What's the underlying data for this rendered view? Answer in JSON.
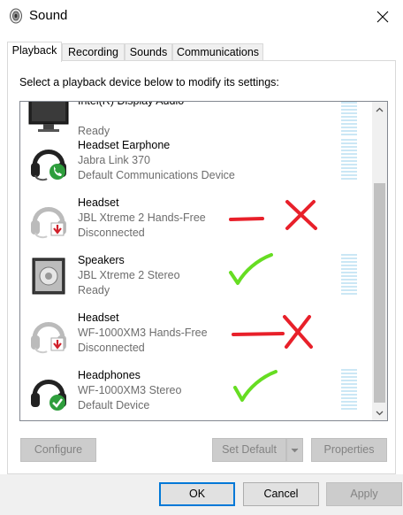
{
  "window": {
    "title": "Sound",
    "icon": "speaker-icon",
    "close_icon": "close-icon"
  },
  "tabs": [
    {
      "label": "Playback",
      "active": true
    },
    {
      "label": "Recording",
      "active": false
    },
    {
      "label": "Sounds",
      "active": false
    },
    {
      "label": "Communications",
      "active": false
    }
  ],
  "instruction": "Select a playback device below to modify its settings:",
  "devices": [
    {
      "name": "Intel(R) Display Audio",
      "description": "",
      "status": "Ready",
      "icon": "monitor-icon",
      "badge": ""
    },
    {
      "name": "Headset Earphone",
      "description": "Jabra Link 370",
      "status": "Default Communications Device",
      "icon": "headset-icon",
      "badge": "phone-badge"
    },
    {
      "name": "Headset",
      "description": "JBL Xtreme 2 Hands-Free",
      "status": "Disconnected",
      "icon": "headset-icon",
      "badge": "disconnected-badge"
    },
    {
      "name": "Speakers",
      "description": "JBL Xtreme 2 Stereo",
      "status": "Ready",
      "icon": "speaker-box-icon",
      "badge": ""
    },
    {
      "name": "Headset",
      "description": "WF-1000XM3 Hands-Free",
      "status": "Disconnected",
      "icon": "headset-icon",
      "badge": "disconnected-badge"
    },
    {
      "name": "Headphones",
      "description": "WF-1000XM3 Stereo",
      "status": "Default Device",
      "icon": "headphones-icon",
      "badge": "default-check-badge"
    }
  ],
  "buttons": {
    "configure": "Configure",
    "set_default": "Set Default",
    "properties": "Properties",
    "ok": "OK",
    "cancel": "Cancel",
    "apply": "Apply"
  },
  "colors": {
    "accent": "#0078d7",
    "annotation_red": "#e8202a",
    "annotation_green": "#66dd22",
    "meter": "#cbe7f5"
  }
}
